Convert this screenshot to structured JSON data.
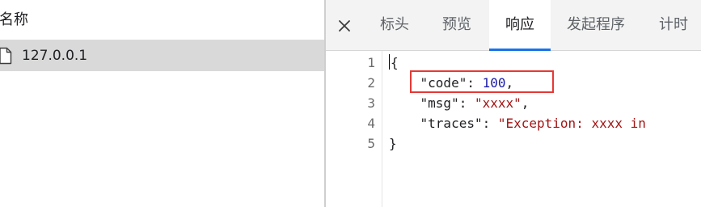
{
  "request_list": {
    "column_header": "名称",
    "rows": [
      {
        "name": "127.0.0.1",
        "icon": "document-icon"
      }
    ]
  },
  "detail": {
    "close_icon": "close-icon",
    "tabs": [
      {
        "label": "标头",
        "active": false
      },
      {
        "label": "预览",
        "active": false
      },
      {
        "label": "响应",
        "active": true
      },
      {
        "label": "发起程序",
        "active": false
      },
      {
        "label": "计时",
        "active": false
      }
    ],
    "response": {
      "line_numbers": [
        "1",
        "2",
        "3",
        "4",
        "5"
      ],
      "lines": {
        "l1": "{",
        "l2_key": "\"code\"",
        "l2_sep": ": ",
        "l2_val": "100",
        "l2_end": ",",
        "l3_key": "\"msg\"",
        "l3_sep": ": ",
        "l3_val": "\"xxxx\"",
        "l3_end": ",",
        "l4_key": "\"traces\"",
        "l4_sep": ": ",
        "l4_val": "\"Exception: xxxx in",
        "l5": "}"
      }
    }
  },
  "colors": {
    "string": "#a31515",
    "number": "#1a1aa6",
    "highlight_box": "#e53935",
    "active_tab_indicator": "#1a73e8",
    "selected_row": "#d9d9d9"
  }
}
